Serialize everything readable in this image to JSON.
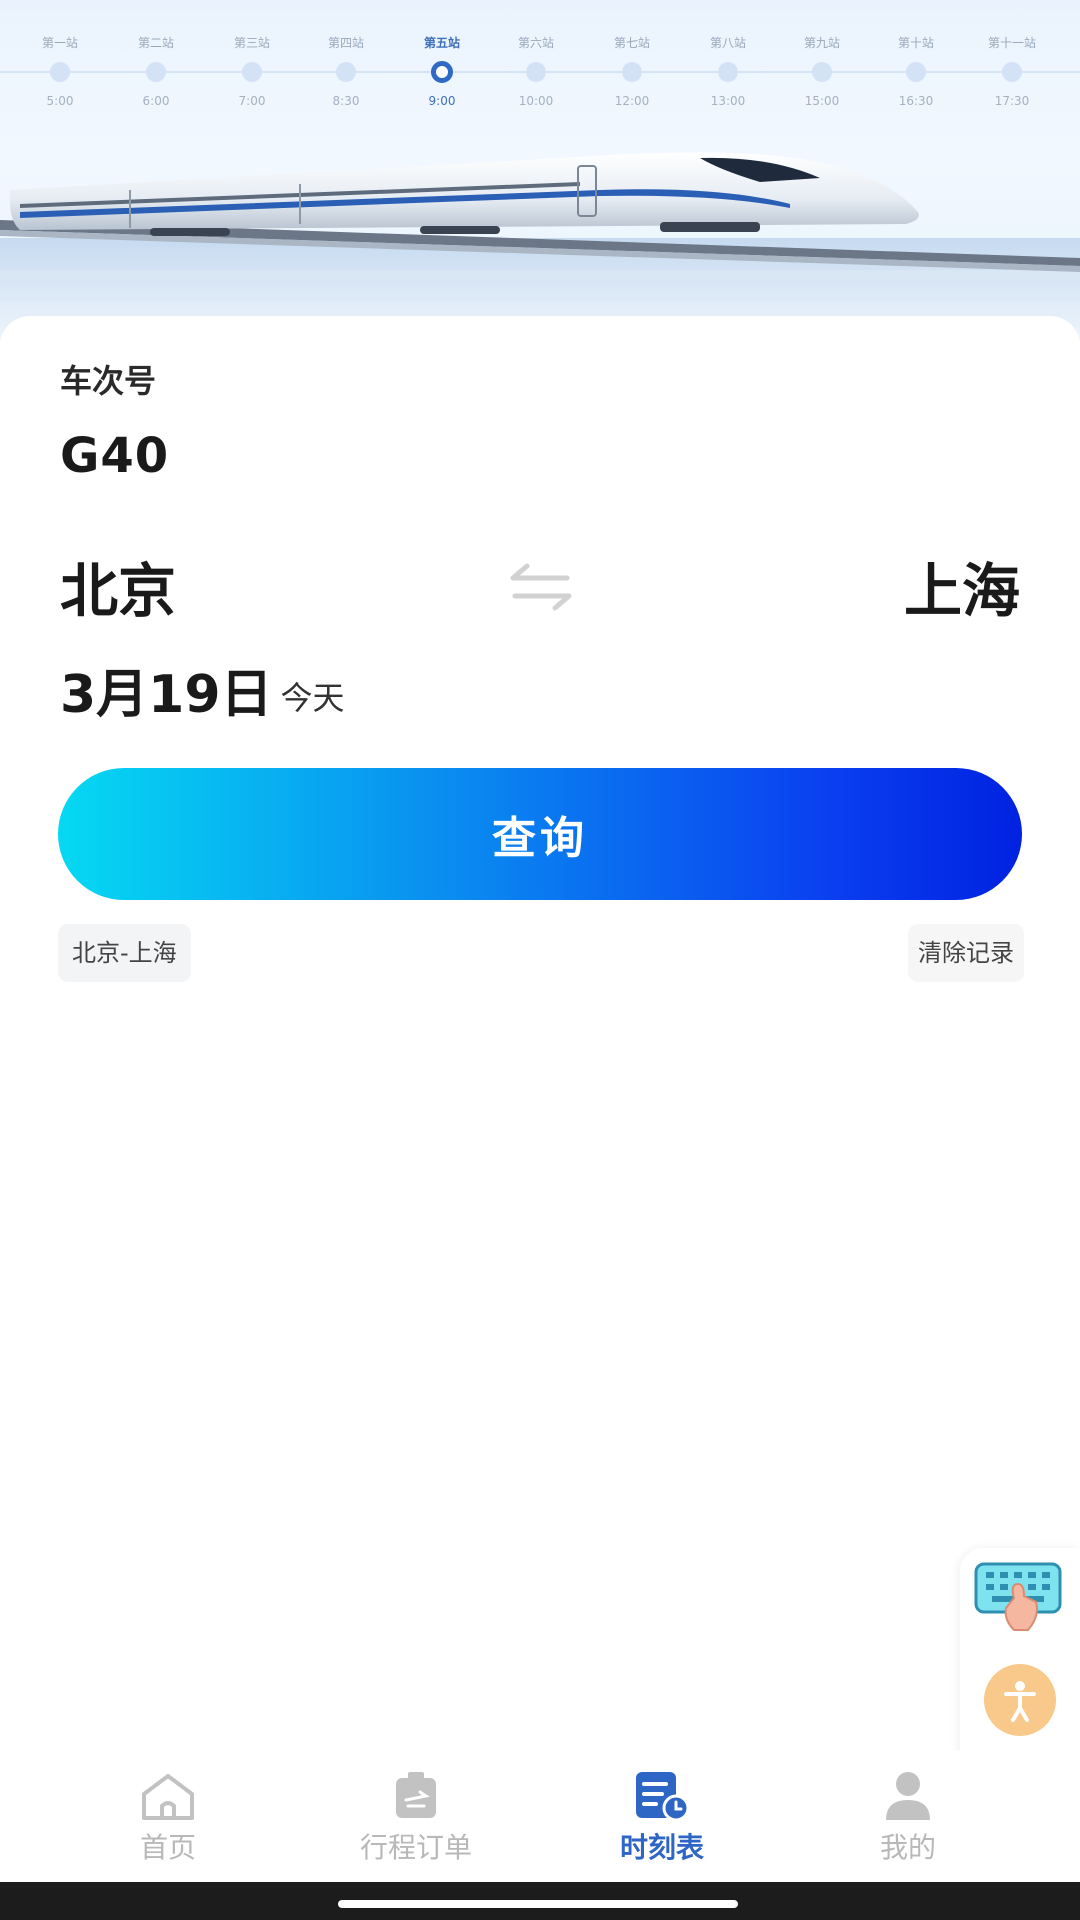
{
  "stations": [
    {
      "name": "第一站",
      "time": "5:00"
    },
    {
      "name": "第二站",
      "time": "6:00"
    },
    {
      "name": "第三站",
      "time": "7:00"
    },
    {
      "name": "第四站",
      "time": "8:30"
    },
    {
      "name": "第五站",
      "time": "9:00",
      "active": true
    },
    {
      "name": "第六站",
      "time": "10:00"
    },
    {
      "name": "第七站",
      "time": "12:00"
    },
    {
      "name": "第八站",
      "time": "13:00"
    },
    {
      "name": "第九站",
      "time": "15:00"
    },
    {
      "name": "第十站",
      "time": "16:30"
    },
    {
      "name": "第十一站",
      "time": "17:30"
    }
  ],
  "form": {
    "train_number_label": "车次号",
    "train_number": "G40",
    "from_city": "北京",
    "to_city": "上海",
    "date": "3月19日",
    "date_note": "今天",
    "query_label": "查询"
  },
  "history": {
    "items": [
      "北京-上海"
    ],
    "clear_label": "清除记录"
  },
  "tabs": [
    {
      "label": "首页",
      "icon": "home-icon"
    },
    {
      "label": "行程订单",
      "icon": "luggage-icon"
    },
    {
      "label": "时刻表",
      "icon": "timetable-icon",
      "active": true
    },
    {
      "label": "我的",
      "icon": "user-icon"
    }
  ],
  "colors": {
    "accent": "#2d66c4",
    "button_gradient_start": "#06d9f2",
    "button_gradient_end": "#0022e0",
    "inactive": "#b8b8b8"
  }
}
